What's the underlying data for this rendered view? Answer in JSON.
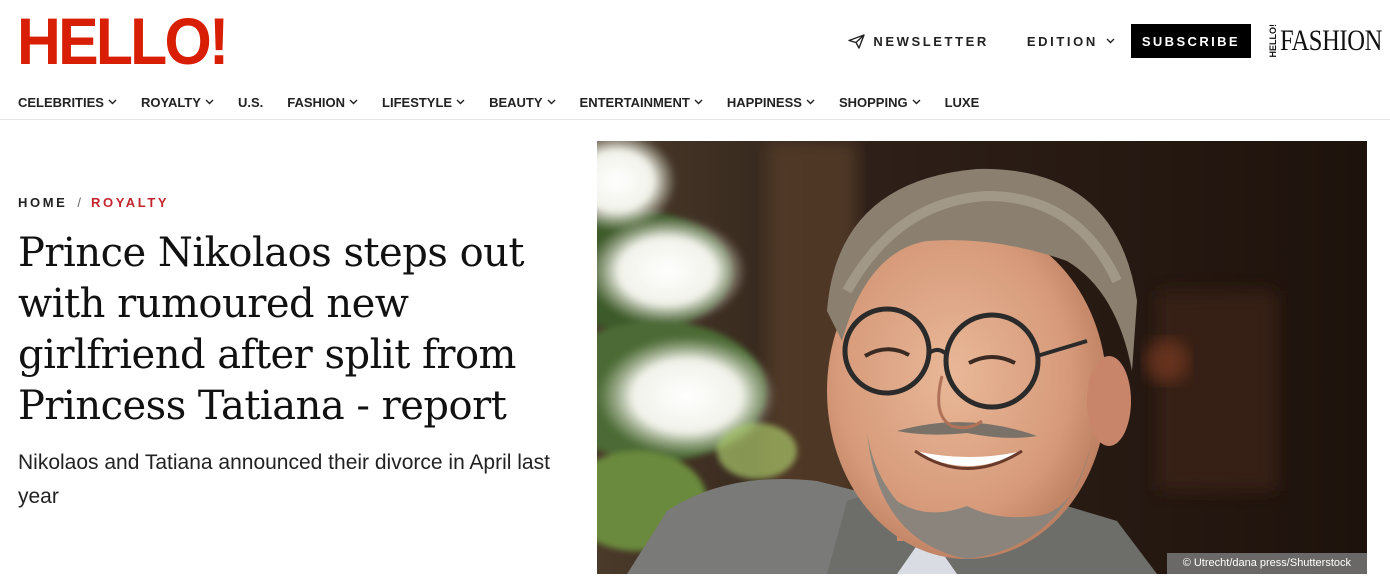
{
  "brand": {
    "logo_text": "HELLO!",
    "logo_color": "#d81e05"
  },
  "header": {
    "newsletter_label": "NEWSLETTER",
    "edition_label": "EDITION",
    "subscribe_label": "SUBSCRIBE",
    "fashion_logo": {
      "mini": "HELLO!",
      "word": "FASHION"
    }
  },
  "nav": {
    "items": [
      {
        "label": "CELEBRITIES",
        "has_dropdown": true
      },
      {
        "label": "ROYALTY",
        "has_dropdown": true
      },
      {
        "label": "U.S.",
        "has_dropdown": false
      },
      {
        "label": "FASHION",
        "has_dropdown": true
      },
      {
        "label": "LIFESTYLE",
        "has_dropdown": true
      },
      {
        "label": "BEAUTY",
        "has_dropdown": true
      },
      {
        "label": "ENTERTAINMENT",
        "has_dropdown": true
      },
      {
        "label": "HAPPINESS",
        "has_dropdown": true
      },
      {
        "label": "SHOPPING",
        "has_dropdown": true
      },
      {
        "label": "LUXE",
        "has_dropdown": false
      }
    ]
  },
  "breadcrumb": {
    "home": "HOME",
    "separator": "/",
    "category": "ROYALTY",
    "category_color": "#c3252c"
  },
  "article": {
    "headline": "Prince Nikolaos steps out with rumoured new girlfriend after split from Princess Tatiana - report",
    "standfirst": "Nikolaos and Tatiana announced their divorce in April last year",
    "image_credit": "© Utrecht/dana press/Shutterstock"
  },
  "icons": {
    "newsletter": "paper-plane-icon",
    "dropdown": "chevron-down-icon"
  }
}
